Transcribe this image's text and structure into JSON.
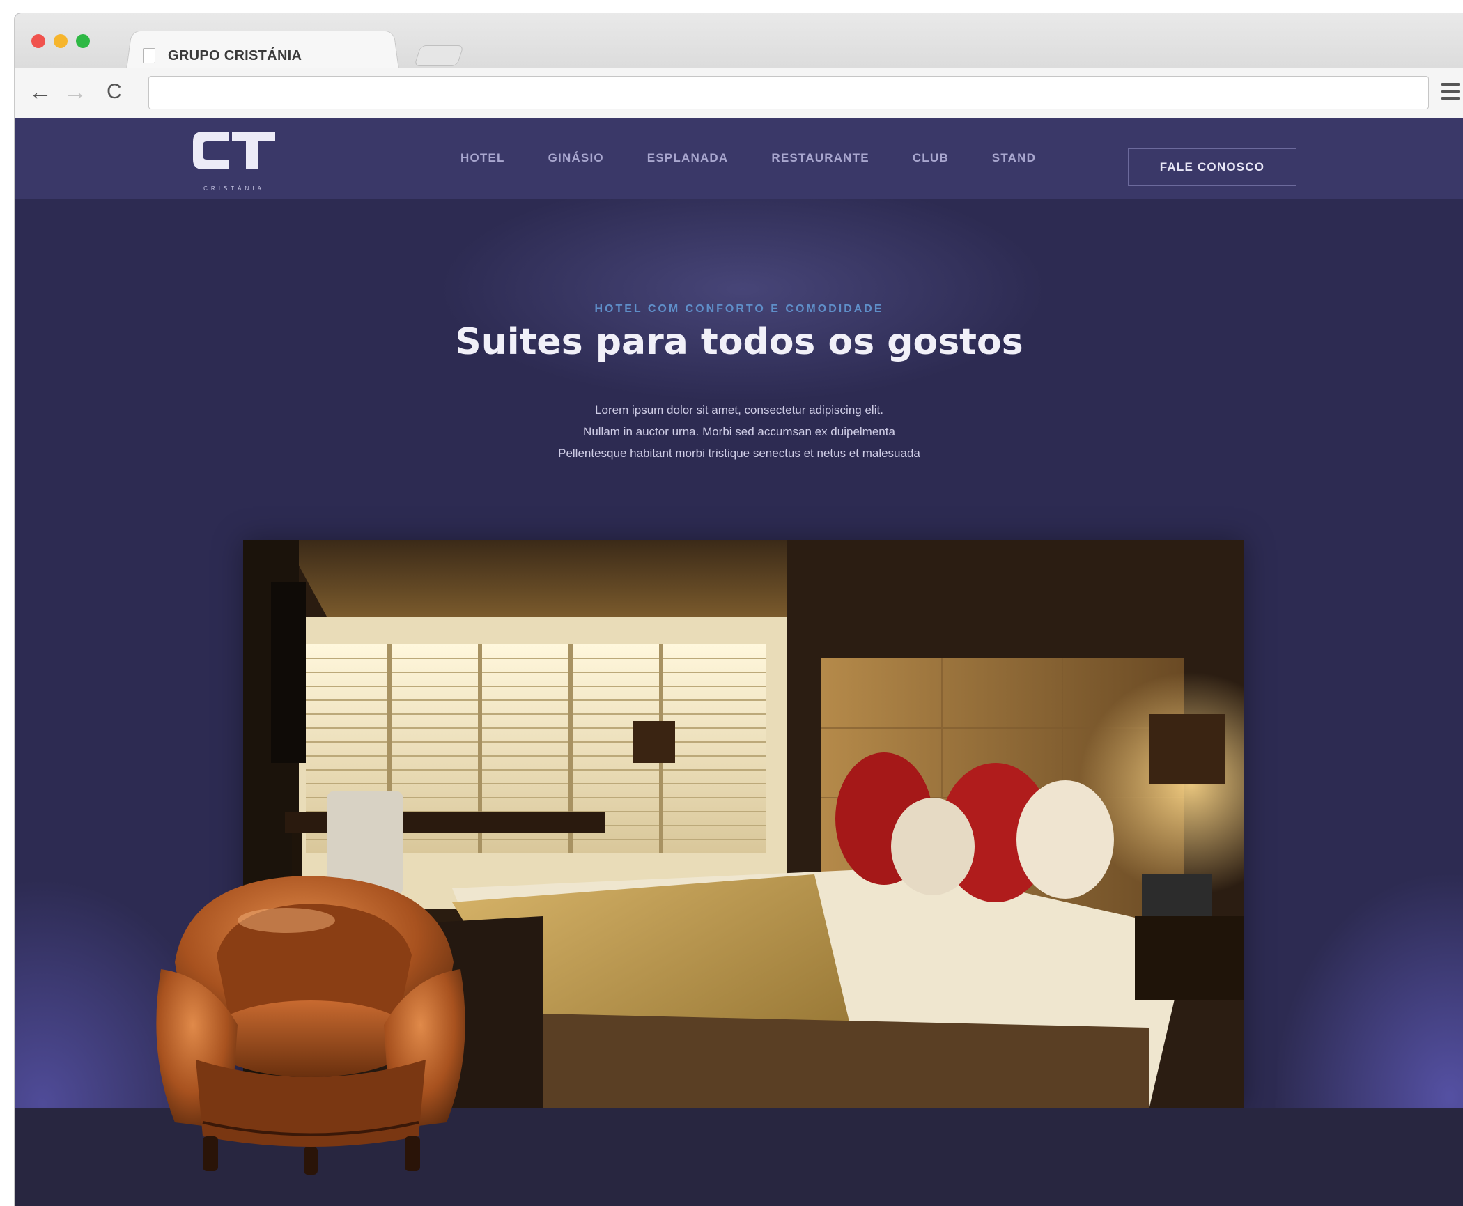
{
  "browser": {
    "tab_title": "GRUPO CRISTÁNIA",
    "nav_back": "←",
    "nav_forward": "→",
    "nav_reload": "C"
  },
  "site": {
    "logo_mark": "CT",
    "logo_sub": "CRISTÁNIA",
    "nav": [
      "HOTEL",
      "GINÁSIO",
      "ESPLANADA",
      "RESTAURANTE",
      "CLUB",
      "STAND"
    ],
    "cta": "FALE CONOSCO"
  },
  "hero": {
    "eyebrow": "HOTEL COM CONFORTO E COMODIDADE",
    "title": "Suites para todos os gostos",
    "lede": [
      "Lorem ipsum dolor sit amet, consectetur adipiscing elit.",
      "Nullam in auctor urna. Morbi sed accumsan ex duipelmenta",
      "Pellentesque habitant morbi tristique senectus et netus et malesuada"
    ]
  },
  "colors": {
    "header_bg": "#3a3868",
    "hero_bg": "#2d2b52",
    "eyebrow": "#5f8fc9",
    "nav_text": "#a9a7cf"
  }
}
